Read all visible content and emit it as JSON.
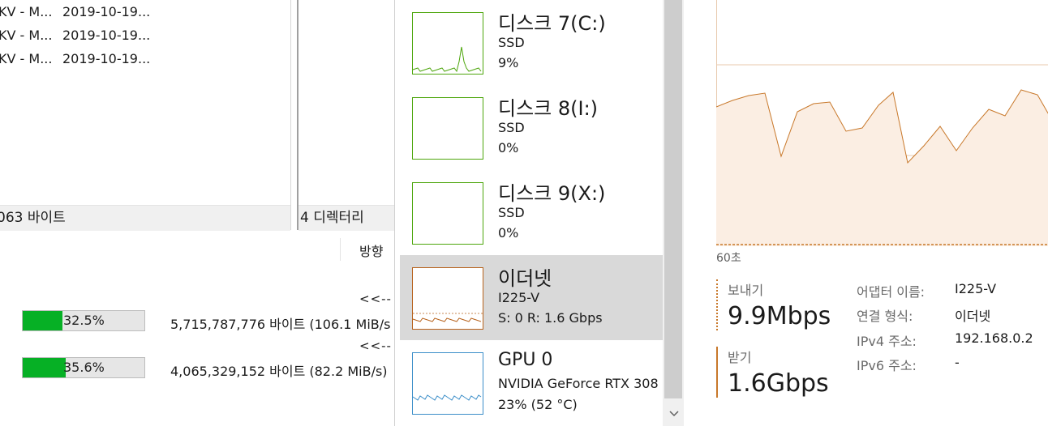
{
  "file_pane": {
    "rows": [
      {
        "name": "KV - M...",
        "date": "2019-10-19..."
      },
      {
        "name": "KV - M...",
        "date": "2019-10-19..."
      },
      {
        "name": "KV - M...",
        "date": "2019-10-19..."
      }
    ],
    "status_left": "063 바이트",
    "status_right": "4 디렉터리"
  },
  "transfer": {
    "direction_header": "방향",
    "jobs": [
      {
        "direction": "<<--",
        "percent_label": "32.5%",
        "progress": 0.325,
        "bytes": "5,715,787,776 바이트 (106.1 MiB/s"
      },
      {
        "direction": "<<--",
        "percent_label": "35.6%",
        "progress": 0.356,
        "bytes": "4,065,329,152 바이트 (82.2 MiB/s)"
      }
    ]
  },
  "devices": [
    {
      "name": "디스크 7(C:)",
      "line2": "SSD",
      "line3": "9%",
      "color": "#4da60c",
      "kind": "disk-active",
      "selected": false
    },
    {
      "name": "디스크 8(I:)",
      "line2": "SSD",
      "line3": "0%",
      "color": "#4da60c",
      "kind": "disk-idle",
      "selected": false
    },
    {
      "name": "디스크 9(X:)",
      "line2": "SSD",
      "line3": "0%",
      "color": "#4da60c",
      "kind": "disk-idle",
      "selected": false
    },
    {
      "name": "이더넷",
      "line2": "I225-V",
      "line3": "S: 0  R: 1.6 Gbps",
      "color": "#b7621c",
      "kind": "net",
      "selected": true
    },
    {
      "name": "GPU 0",
      "line2": "NVIDIA GeForce RTX 308",
      "line3": "23%  (52 °C)",
      "color": "#3c8ec9",
      "kind": "gpu",
      "selected": false
    }
  ],
  "ethernet": {
    "time_label": "60초",
    "send_label": "보내기",
    "send_value": "9.9Mbps",
    "recv_label": "받기",
    "recv_value": "1.6Gbps",
    "info": [
      {
        "key": "어댑터 이름:",
        "value": "I225-V"
      },
      {
        "key": "연결 형식:",
        "value": "이더넷"
      },
      {
        "key": "IPv4 주소:",
        "value": "192.168.0.2"
      },
      {
        "key": "IPv6 주소:",
        "value": "-"
      }
    ],
    "accent": "#c8782a",
    "fill": "#fbeee3"
  }
}
